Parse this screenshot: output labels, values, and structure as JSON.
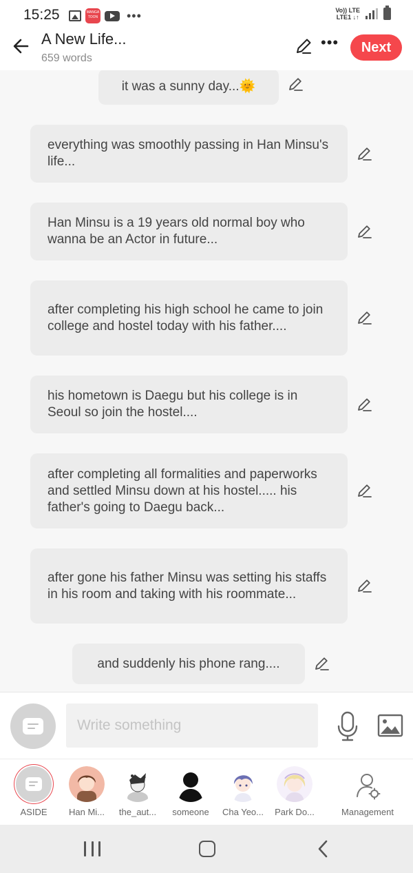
{
  "status_bar": {
    "time": "15:25",
    "app_icon_text": "MANGA TOON",
    "network_top": "Vo)) LTE",
    "network_bottom": "LTE1 ↓↑"
  },
  "header": {
    "title": "A New Life...",
    "word_count": "659 words",
    "next_label": "Next"
  },
  "messages": [
    {
      "text": "it was a sunny day...🌞"
    },
    {
      "text": "everything was smoothly passing in Han Minsu's life..."
    },
    {
      "text": "Han Minsu is a 19 years old normal boy who wanna be an Actor in future..."
    },
    {
      "text": "after completing his high school he came to join college and hostel today with his father...."
    },
    {
      "text": "his hometown is Daegu but his college is in Seoul so join the hostel...."
    },
    {
      "text": "after completing all formalities and paperworks and settled Minsu down at his hostel..... his father's going to Daegu back..."
    },
    {
      "text": "after gone his father Minsu was setting his staffs in his room and taking with his roommate..."
    },
    {
      "text": "and suddenly his phone rang...."
    }
  ],
  "composer": {
    "placeholder": "Write something"
  },
  "characters": [
    {
      "label": "ASIDE"
    },
    {
      "label": "Han Mi..."
    },
    {
      "label": "the_aut..."
    },
    {
      "label": "someone"
    },
    {
      "label": "Cha Yeo..."
    },
    {
      "label": "Park Do..."
    },
    {
      "label": "Management"
    }
  ],
  "colors": {
    "accent": "#f5474c",
    "bubble": "#ececec",
    "background": "#f7f7f7"
  }
}
